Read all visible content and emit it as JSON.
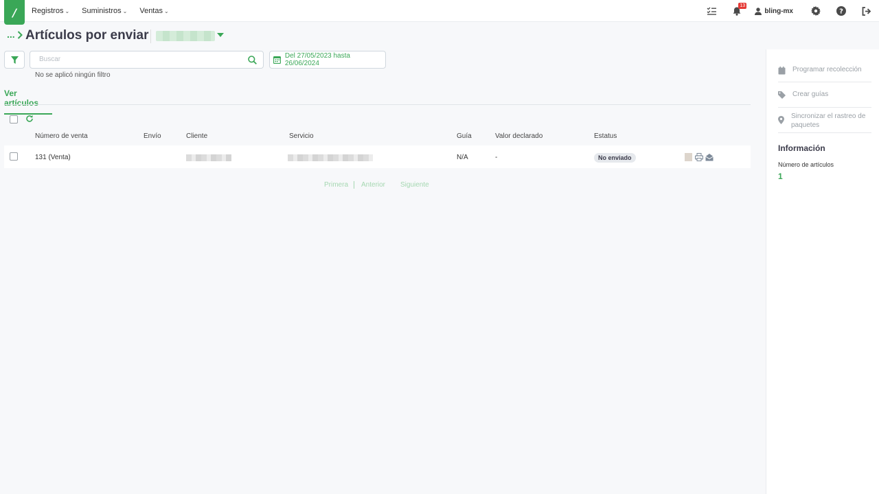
{
  "colors": {
    "accent": "#3aa757",
    "badge": "#e53935",
    "text_dark": "#3b3b4a"
  },
  "logo": {
    "glyph": "/"
  },
  "nav": {
    "menu": [
      {
        "label": "Registros"
      },
      {
        "label": "Suministros"
      },
      {
        "label": "Ventas"
      }
    ],
    "notifications_count": "13",
    "user": "bling-mx",
    "icons": [
      "tasks-icon",
      "bell-icon",
      "user-icon",
      "gear-icon",
      "help-icon",
      "logout-icon"
    ]
  },
  "header": {
    "breadcrumb": "...",
    "title": "Artículos por enviar"
  },
  "filters": {
    "search_placeholder": "Buscar",
    "date_range": "Del 27/05/2023 hasta 26/06/2024",
    "note": "No se aplicó ningún filtro"
  },
  "tabs": [
    {
      "label": "Ver artículos",
      "active": true
    }
  ],
  "table": {
    "columns": [
      "Número de venta",
      "Envío",
      "Cliente",
      "Servicio",
      "Guía",
      "Valor declarado",
      "Estatus"
    ],
    "rows": [
      {
        "sale": "131 (Venta)",
        "shipping": "",
        "guide": "N/A",
        "declared_value": "-",
        "status": "No enviado"
      }
    ]
  },
  "pagination": {
    "first": "Primera",
    "prev": "Anterior",
    "next": "Siguiente"
  },
  "sidebar": {
    "actions": [
      {
        "label": "Programar recolección",
        "icon": "calendar-icon"
      },
      {
        "label": "Crear guías",
        "icon": "tag-icon"
      },
      {
        "label": "Sincronizar el rastreo de paquetes",
        "icon": "map-pin-icon"
      }
    ],
    "info_title": "Información",
    "info_label": "Número de artículos",
    "info_value": "1"
  }
}
